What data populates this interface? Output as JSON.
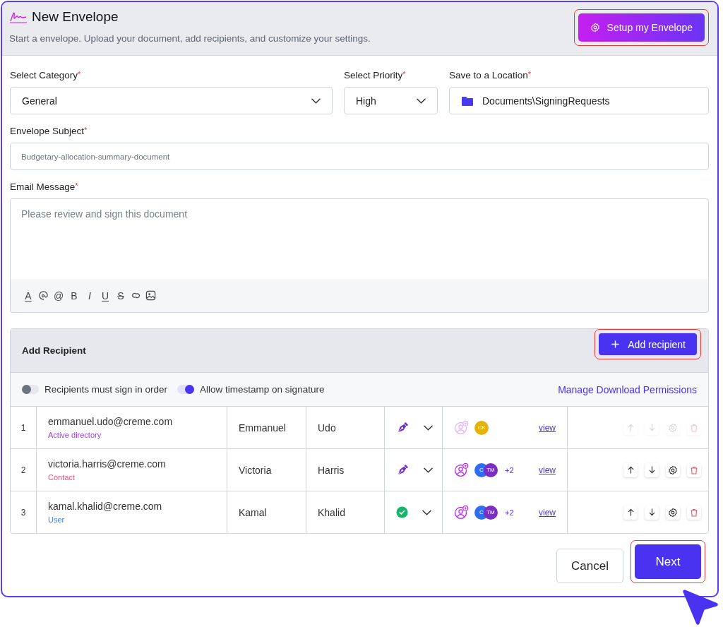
{
  "header": {
    "title": "New Envelope",
    "subtitle": "Start a envelope. Upload your document, add recipients, and customize your settings.",
    "setup_button": {
      "label": "Setup my Envelope",
      "highlighted": true
    }
  },
  "selects": [
    {
      "kind": "dropdown",
      "label": "Select Category",
      "required_mark": "*",
      "value": "General"
    },
    {
      "kind": "dropdown",
      "label": "Select Priority",
      "required_mark": "*",
      "value": "High"
    },
    {
      "kind": "folder",
      "label": "Save to a Location",
      "required_mark": "*",
      "value": "Documents\\SigningRequests"
    }
  ],
  "subject": {
    "label": "Envelope Subject",
    "required_mark": "*",
    "placeholder": "Budgetary-allocation-summary-document"
  },
  "message": {
    "label": "Email Message",
    "required_mark": "*",
    "placeholder": "Please review and sign this document",
    "toolbar": [
      {
        "kind": "text-color",
        "glyph": "A"
      },
      {
        "kind": "emoji"
      },
      {
        "kind": "mention",
        "glyph": "@"
      },
      {
        "kind": "bold",
        "glyph": "B"
      },
      {
        "kind": "italic",
        "glyph": "I"
      },
      {
        "kind": "underline",
        "glyph": "U"
      },
      {
        "kind": "strike",
        "glyph": "S"
      },
      {
        "kind": "link"
      },
      {
        "kind": "image"
      }
    ]
  },
  "recipients": {
    "title": "Add Recipient",
    "add_button": {
      "label": "Add recipient",
      "highlighted": true
    },
    "toggles": [
      {
        "label": "Recipients must sign in order",
        "on": false
      },
      {
        "label": "Allow timestamp on signature",
        "on": true
      }
    ],
    "permissions_link": "Manage Download Permissions",
    "rows": [
      {
        "number": "1",
        "email": "emmanuel.udo@creme.com",
        "source": "Active directory",
        "color": "#9b3fe0",
        "first_name": "Emmanuel",
        "last_name": "Udo",
        "kind": "sign",
        "avatars": [
          {
            "initials": "CK",
            "color": "#e4b20a"
          }
        ],
        "view": "view",
        "disabled": true
      },
      {
        "number": "2",
        "email": "victoria.harris@creme.com",
        "source": "Contact",
        "color": "#ef4f7a",
        "first_name": "Victoria",
        "last_name": "Harris",
        "kind": "sign",
        "avatars": [
          {
            "initials": "C",
            "color": "#2f6fef"
          },
          {
            "initials": "TM",
            "color": "#7a2fc4"
          }
        ],
        "more": "+2",
        "view": "view",
        "disabled": false
      },
      {
        "number": "3",
        "email": "kamal.khalid@creme.com",
        "source": "User",
        "color": "#3f7ef0",
        "first_name": "Kamal",
        "last_name": "Khalid",
        "kind": "done",
        "avatars": [
          {
            "initials": "C",
            "color": "#2f6fef"
          },
          {
            "initials": "TM",
            "color": "#7a2fc4"
          }
        ],
        "more": "+2",
        "view": "view",
        "disabled": false
      }
    ]
  },
  "footer": {
    "cancel": {
      "label": "Cancel",
      "highlighted": false
    },
    "next": {
      "label": "Next",
      "highlighted": true
    }
  }
}
